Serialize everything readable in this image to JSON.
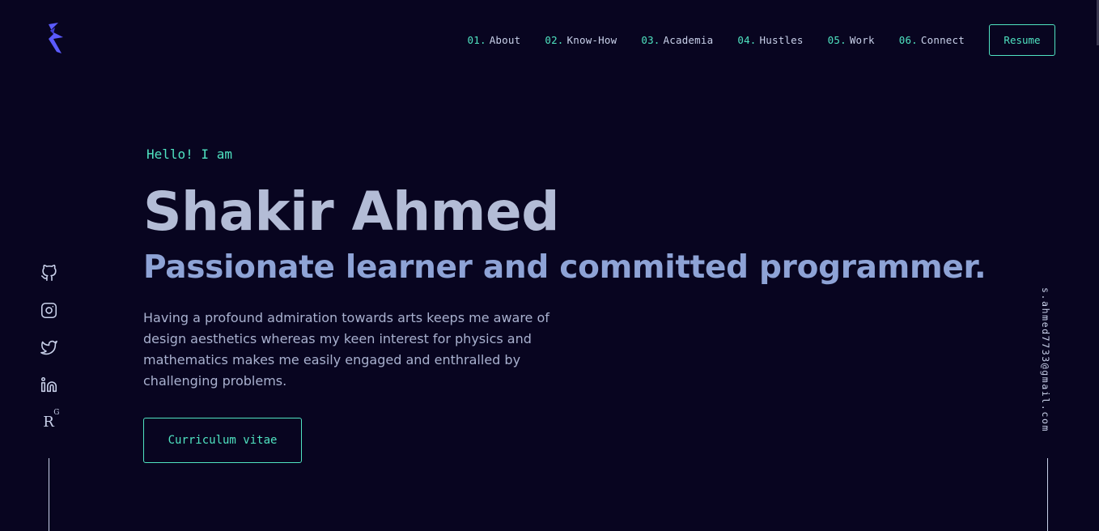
{
  "nav": {
    "items": [
      {
        "num": "01.",
        "label": "About"
      },
      {
        "num": "02.",
        "label": "Know-How"
      },
      {
        "num": "03.",
        "label": "Academia"
      },
      {
        "num": "04.",
        "label": "Hustles"
      },
      {
        "num": "05.",
        "label": "Work"
      },
      {
        "num": "06.",
        "label": "Connect"
      }
    ],
    "resume_label": "Resume"
  },
  "hero": {
    "greeting": "Hello! I am",
    "name": "Shakir Ahmed",
    "tagline": "Passionate learner and committed programmer.",
    "bio": "Having a profound admiration towards arts keeps me aware of design aesthetics whereas my keen interest for physics and mathematics makes me easily engaged and enthralled by challenging problems.",
    "cta_label": "Curriculum vitae"
  },
  "social": {
    "icons": [
      "github-icon",
      "instagram-icon",
      "twitter-icon",
      "linkedin-icon",
      "researchgate-icon"
    ],
    "researchgate_text": "R",
    "researchgate_sup": "G"
  },
  "contact": {
    "email": "s.ahmed7733@gmail.com"
  },
  "colors": {
    "background": "#080520",
    "accent": "#4fe3c1",
    "logo": "#5b5bff",
    "heading": "#b3bcd6",
    "tagline": "#8ea3d6",
    "text": "#a9b1cf"
  }
}
